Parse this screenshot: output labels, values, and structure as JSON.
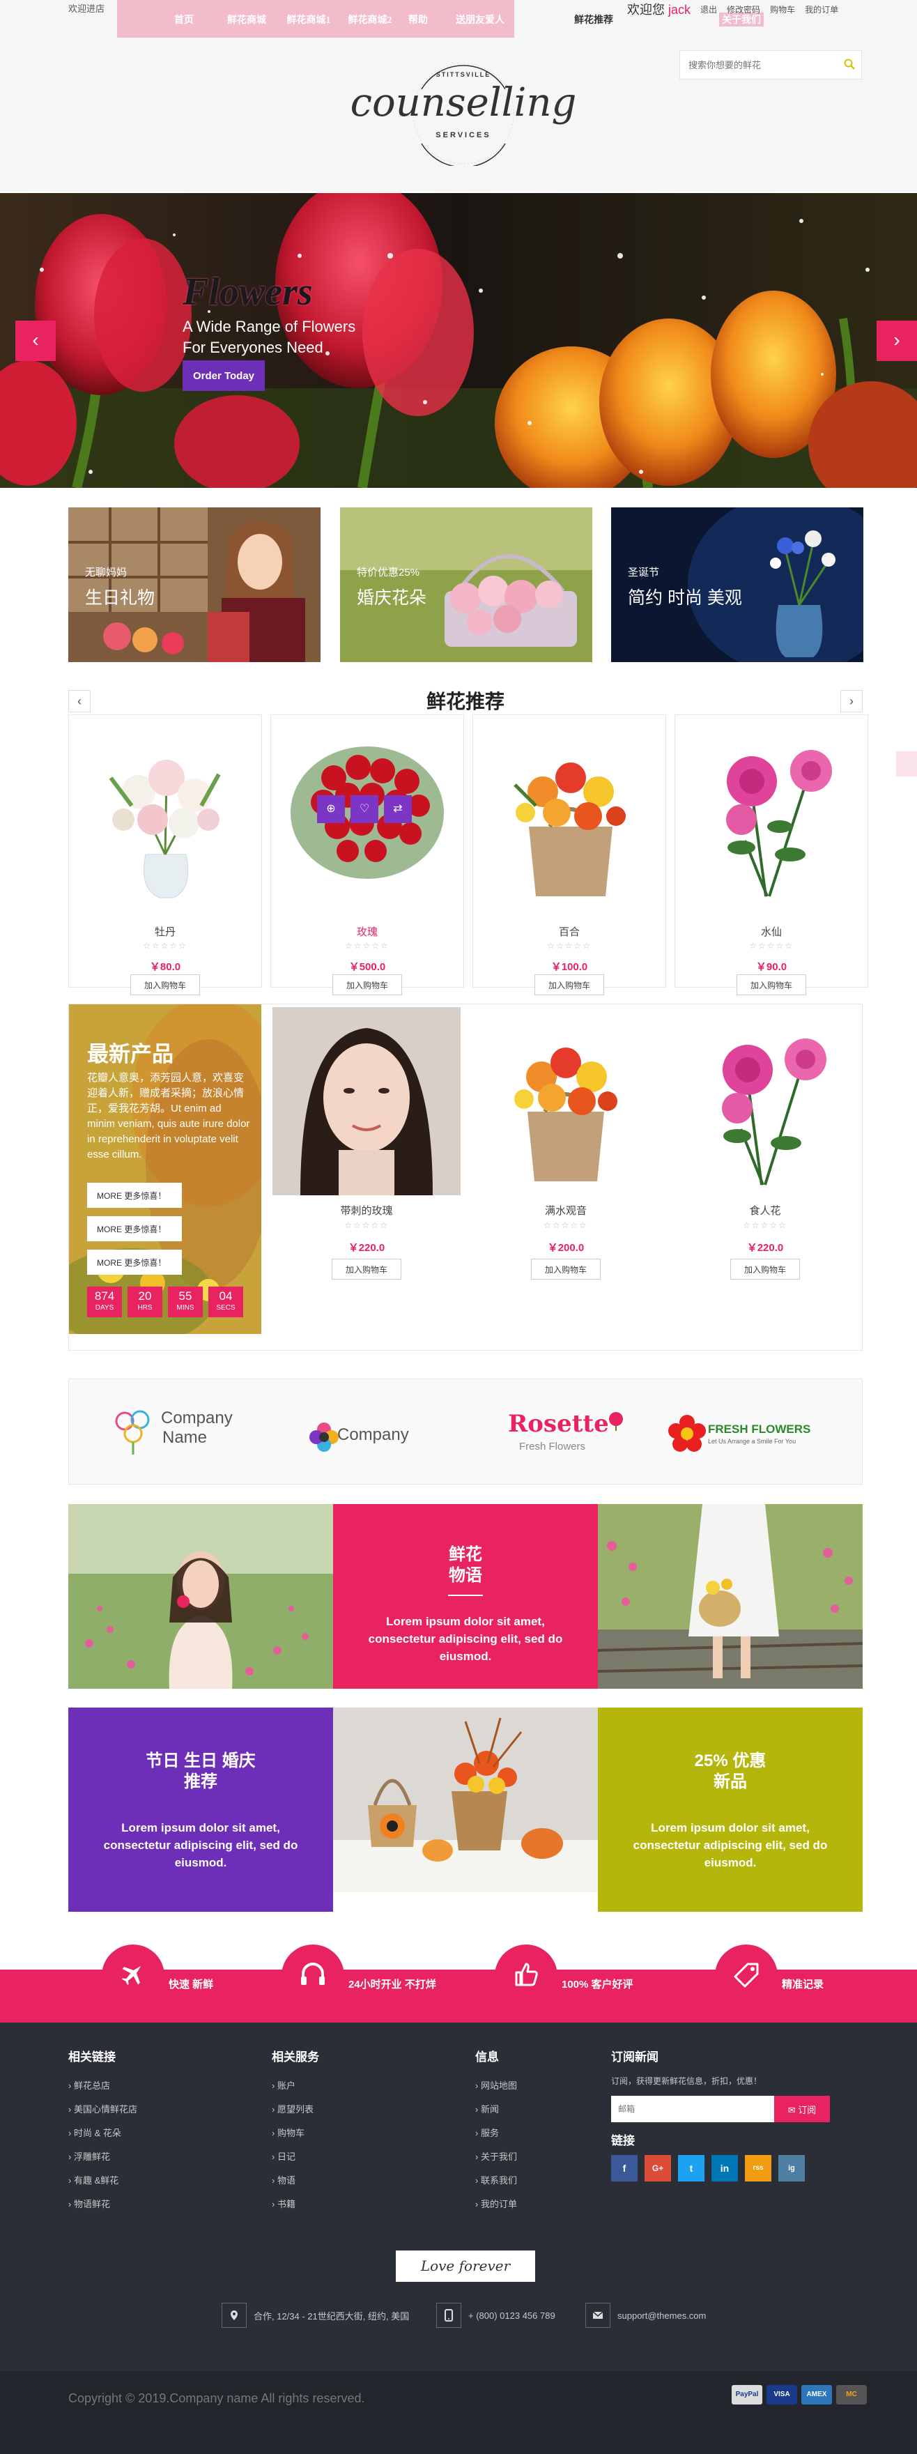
{
  "header": {
    "welcome_left": "欢迎进店",
    "nav": [
      "首页",
      "鲜花商城",
      "鲜花商城1",
      "鲜花商城2",
      "帮助",
      "送朋友爱人",
      "鲜花推荐",
      "关于我们"
    ],
    "greeting": "欢迎您",
    "username": "jack",
    "user_links": [
      "退出",
      "修改密码",
      "购物车",
      "我的订单"
    ],
    "search_placeholder": "搜索你想要的鲜花",
    "logo_top": "STITTSVILLE",
    "logo_main": "counselling",
    "logo_bottom": "SERVICES"
  },
  "slider": {
    "title": "Flowers",
    "subtitle_line1": "A Wide Range of Flowers",
    "subtitle_line2": "For Everyones Need",
    "button": "Order Today",
    "prev_icon": "‹",
    "next_icon": "›"
  },
  "banners": [
    {
      "sub": "无聊妈妈",
      "title": "生日礼物"
    },
    {
      "sub": "特价优惠25%",
      "title": "婚庆花朵"
    },
    {
      "sub": "圣诞节",
      "title": "简约 时尚 美观"
    }
  ],
  "recommend": {
    "title": "鲜花推荐",
    "products": [
      {
        "name": "牡丹",
        "price": "￥80.0",
        "button": "加入购物车"
      },
      {
        "name": "玫瑰",
        "price": "￥500.0",
        "button": "加入购物车"
      },
      {
        "name": "百合",
        "price": "￥100.0",
        "button": "加入购物车"
      },
      {
        "name": "水仙",
        "price": "￥90.0",
        "button": "加入购物车"
      }
    ],
    "stars": "☆☆☆☆☆"
  },
  "new_products": {
    "title": "最新产品",
    "desc": "花瓣人意奥，添芳园人意，欢喜变迎着人新，赠成者采摘；放浪心情正，爱我花芳胡。Ut enim ad minim veniam, quis aute irure dolor in reprehenderit in voluptate velit esse cillum.",
    "buttons": [
      "MORE 更多惊喜！",
      "MORE 更多惊喜！",
      "MORE 更多惊喜！"
    ],
    "countdown": [
      {
        "num": "874",
        "unit": "DAYS"
      },
      {
        "num": "20",
        "unit": "HRS"
      },
      {
        "num": "55",
        "unit": "MINS"
      },
      {
        "num": "04",
        "unit": "SECS"
      }
    ],
    "products": [
      {
        "name": "带刺的玫瑰",
        "price": "￥220.0",
        "button": "加入购物车"
      },
      {
        "name": "满水观音",
        "price": "￥200.0",
        "button": "加入购物车"
      },
      {
        "name": "食人花",
        "price": "￥220.0",
        "button": "加入购物车"
      }
    ]
  },
  "brands": [
    {
      "line1": "Company",
      "line2": "Name"
    },
    {
      "line1": "Company",
      "line2": ""
    },
    {
      "line1": "Rosette",
      "line2": "Fresh Flowers"
    },
    {
      "line1": "FRESH FLOWERS",
      "line2": "Let Us Arrange a Smile For You"
    }
  ],
  "tiles": [
    {
      "title": "鲜花\n物语",
      "desc": "Lorem ipsum dolor sit amet, consectetur adipiscing elit, sed do eiusmod."
    },
    {
      "title": "节日 生日 婚庆\n推荐",
      "desc": "Lorem ipsum dolor sit amet, consectetur adipiscing elit, sed do eiusmod."
    },
    {
      "title": "25% 优惠\n新品",
      "desc": "Lorem ipsum dolor sit amet, consectetur adipiscing elit, sed do eiusmod."
    }
  ],
  "features": [
    {
      "label": "快速 新鲜",
      "icon": "plane-icon"
    },
    {
      "label": "24小时开业 不打烊",
      "icon": "headset-icon"
    },
    {
      "label": "100% 客户好评",
      "icon": "thumbs-up-icon"
    },
    {
      "label": "精准记录",
      "icon": "tag-icon"
    }
  ],
  "footer": {
    "col1": {
      "title": "相关链接",
      "links": [
        "鲜花总店",
        "美国心情鲜花店",
        "时尚 & 花朵",
        "浮雕鲜花",
        "有趣 &鲜花",
        "物语鲜花"
      ]
    },
    "col2": {
      "title": "相关服务",
      "links": [
        "账户",
        "愿望列表",
        "购物车",
        "日记",
        "物语",
        "书籍"
      ]
    },
    "col3": {
      "title": "信息",
      "links": [
        "网站地图",
        "新闻",
        "服务",
        "关于我们",
        "联系我们",
        "我的订单"
      ]
    },
    "subscribe": {
      "title": "订阅新闻",
      "text": "订阅，获得更新鲜花信息，折扣，优惠！",
      "placeholder": "邮箱",
      "button": "订阅"
    },
    "links_title": "链接",
    "social": [
      "f",
      "G+",
      "t",
      "in",
      "rss",
      "ig"
    ],
    "signature": "Love forever",
    "address": "合作, 12/34 - 21世纪西大街, 纽约, 美国",
    "phone": "+ (800) 0123 456 789",
    "email": "support@themes.com",
    "copyright": "Copyright © 2019.Company name All rights reserved.",
    "payments": [
      "PayPal",
      "VISA",
      "AMEX",
      "MC"
    ]
  },
  "colors": {
    "accent": "#e8235f",
    "purple": "#6e2fb8",
    "olive": "#b5b60c",
    "footer": "#2a2e37"
  }
}
